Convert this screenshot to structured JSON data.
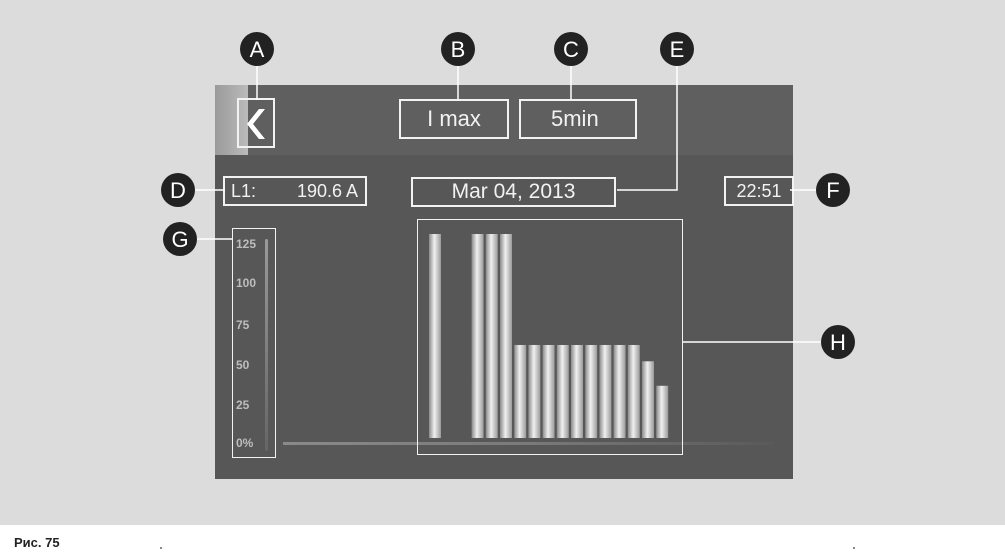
{
  "screen": {
    "back_icon": "chevron-left-icon",
    "mode_label": "I max",
    "period_label": "5min",
    "phase_name": "L1:",
    "phase_value": "190.6 A",
    "date": "Mar 04, 2013",
    "time": "22:51"
  },
  "scale": {
    "ticks": [
      "125",
      "100",
      "75",
      "50",
      "25",
      "0%"
    ]
  },
  "bar_chart": {
    "ymax": 125,
    "bars": [
      125,
      0,
      0,
      125,
      125,
      125,
      57,
      57,
      57,
      57,
      57,
      57,
      57,
      57,
      57,
      47,
      32
    ]
  },
  "callouts": {
    "a": "A",
    "b": "B",
    "c": "C",
    "d": "D",
    "e": "E",
    "f": "F",
    "g": "G",
    "h": "H"
  },
  "caption": "Рис. 75",
  "colors": {
    "screen": "#575757",
    "frame": "#dcdcdc",
    "outline": "#f2f2f2",
    "callout": "#222222"
  }
}
